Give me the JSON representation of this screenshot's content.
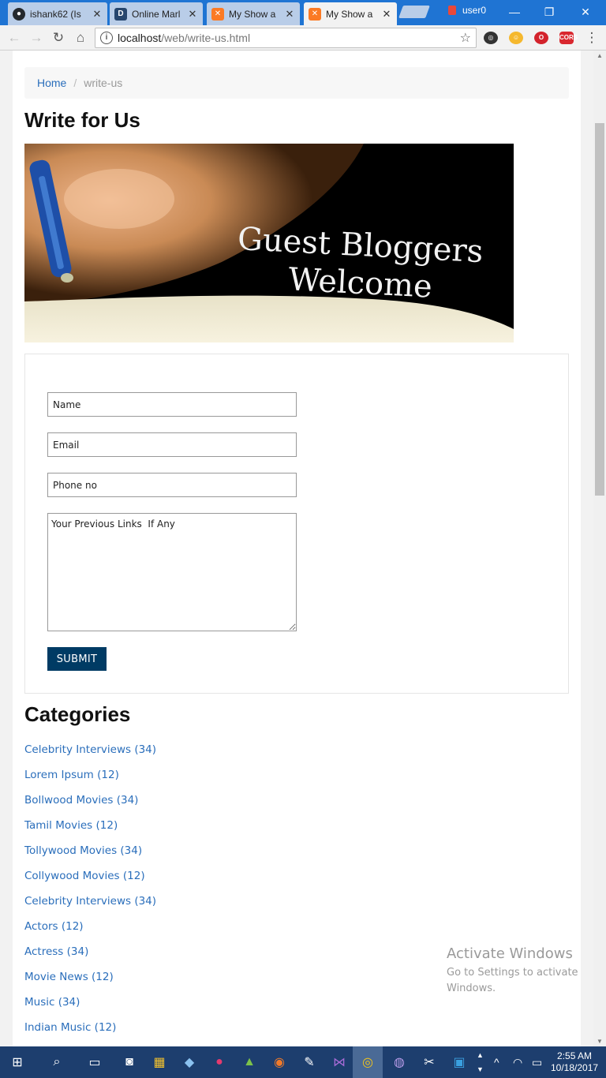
{
  "browser": {
    "tabs": [
      {
        "label": "ishank62 (Is",
        "favicon": "github-icon",
        "active": false
      },
      {
        "label": "Online Marl",
        "favicon": "d-icon",
        "active": false
      },
      {
        "label": "My Show a",
        "favicon": "xampp-icon",
        "active": false
      },
      {
        "label": "My Show a",
        "favicon": "xampp-icon",
        "active": true
      }
    ],
    "profile_name": "user0",
    "url_host": "localhost",
    "url_path": "/web/write-us.html",
    "accent_color": "#1f74d3"
  },
  "page": {
    "breadcrumb": {
      "home": "Home",
      "separator": "/",
      "current": "write-us"
    },
    "title": "Write for Us",
    "banner": {
      "line1": "Guest Bloggers",
      "line2": "Welcome"
    },
    "form": {
      "name_placeholder": "Name",
      "email_placeholder": "Email",
      "phone_placeholder": "Phone no",
      "links_placeholder": "Your Previous Links  If Any",
      "submit_label": "SUBMIT",
      "submit_color": "#003b64"
    },
    "categories_title": "Categories",
    "categories": [
      "Celebrity Interviews (34)",
      "Lorem Ipsum (12)",
      "Bollwood Movies (34)",
      "Tamil Movies (12)",
      "Tollywood Movies (34)",
      "Collywood Movies (12)",
      "Celebrity Interviews (34)",
      "Actors (12)",
      "Actress (34)",
      "Movie News (12)",
      "Music (34)",
      "Indian Music (12)"
    ],
    "link_color": "#2a6ebb"
  },
  "watermark": {
    "line1": "Activate Windows",
    "line2": "Go to Settings to activate",
    "line3": "Windows."
  },
  "taskbar": {
    "time": "2:55 AM",
    "date": "10/18/2017"
  }
}
